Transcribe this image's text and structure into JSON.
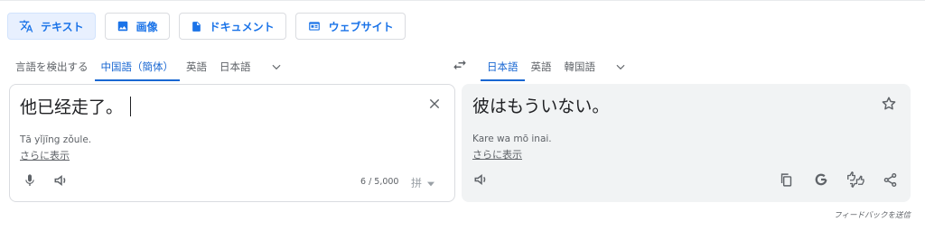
{
  "mode_tabs": [
    {
      "label": "テキスト",
      "icon": "translate-icon",
      "active": true
    },
    {
      "label": "画像",
      "icon": "image-icon",
      "active": false
    },
    {
      "label": "ドキュメント",
      "icon": "document-icon",
      "active": false
    },
    {
      "label": "ウェブサイト",
      "icon": "website-icon",
      "active": false
    }
  ],
  "source_languages": {
    "items": [
      {
        "label": "言語を検出する",
        "selected": false
      },
      {
        "label": "中国語（簡体）",
        "selected": true
      },
      {
        "label": "英語",
        "selected": false
      },
      {
        "label": "日本語",
        "selected": false
      }
    ]
  },
  "target_languages": {
    "items": [
      {
        "label": "日本語",
        "selected": true
      },
      {
        "label": "英語",
        "selected": false
      },
      {
        "label": "韓国語",
        "selected": false
      }
    ]
  },
  "source": {
    "text": "他已经走了。",
    "romanization": "Tā yǐjīng zǒule.",
    "show_more": "さらに表示",
    "char_count": "6 / 5,000",
    "ime_icon": "拼"
  },
  "target": {
    "text": "彼はもういない。",
    "romanization": "Kare wa mō inai.",
    "show_more": "さらに表示"
  },
  "footer": {
    "feedback": "フィードバックを送信"
  },
  "colors": {
    "accent": "#1a73e8",
    "selected_lang": "#1967d2",
    "icon_grey": "#5f6368",
    "target_panel_bg": "#f1f3f4"
  }
}
